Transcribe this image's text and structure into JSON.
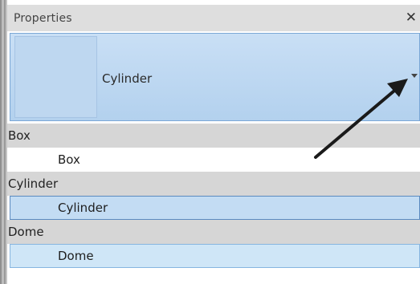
{
  "panel": {
    "title": "Properties",
    "close_glyph": "✕"
  },
  "type_selector": {
    "current_type": "Cylinder",
    "arrow_icon": "chevron-down-icon"
  },
  "type_list": [
    {
      "group": "Box",
      "item": "Box",
      "state": "normal"
    },
    {
      "group": "Cylinder",
      "item": "Cylinder",
      "state": "selected"
    },
    {
      "group": "Dome",
      "item": "Dome",
      "state": "hovered"
    }
  ],
  "colors": {
    "selector_bg": "#b3d1ee",
    "selected_item_bg": "#c3dcf3",
    "selected_item_border": "#5b8ac0",
    "group_header_bg": "#d6d6d6",
    "annotation_arrow": "#1a1a1a"
  }
}
